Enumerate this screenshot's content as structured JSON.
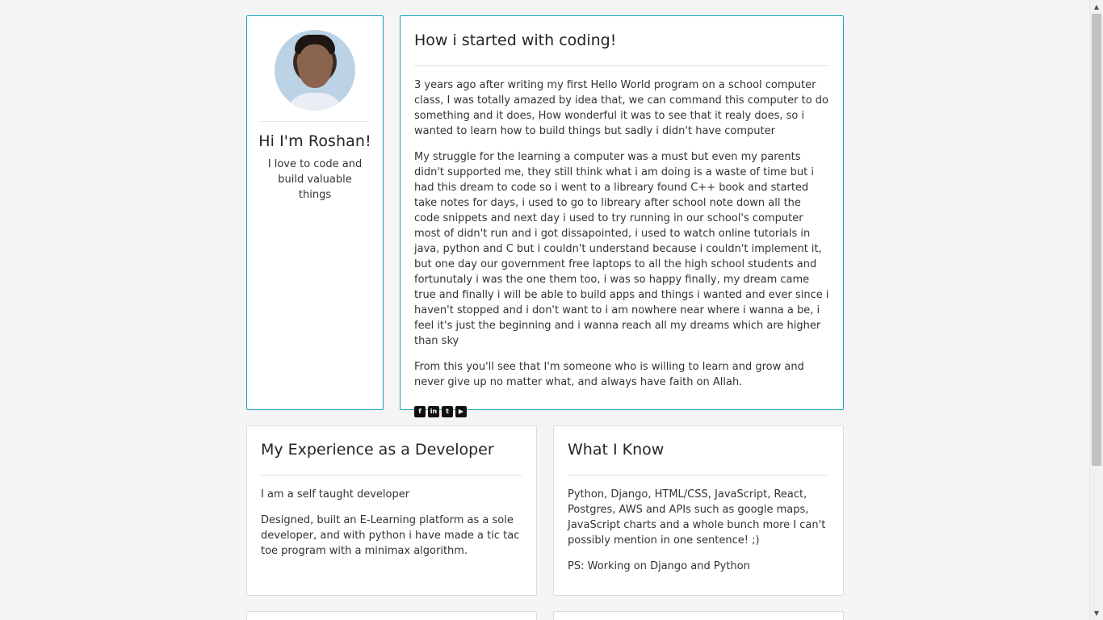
{
  "profile": {
    "greeting": "Hi I'm Roshan!",
    "tagline": "I love to code and build valuable things"
  },
  "story": {
    "title": "How i started with coding!",
    "paragraphs": [
      "3 years ago after writing my first Hello World program on a school computer class, I was totally amazed by idea that, we can command this computer to do something and it does, How wonderful it was to see that it realy does, so i wanted to learn how to build things but sadly i didn't have computer",
      "My struggle for the learning a computer was a must but even my parents didn't supported me, they still think what i am doing is a waste of time but i had this dream to code so i went to a libreary found C++ book and started take notes for days, i used to go to libreary after school note down all the code snippets and next day i used to try running in our school's computer most of didn't run and i got dissapointed, i used to watch online tutorials in java, python and C but i couldn't understand because i couldn't implement it, but one day our government free laptops to all the high school students and fortunutaly i was the one them too, i was so happy finally, my dream came true and finally i will be able to build apps and things i wanted and ever since i haven't stopped and i don't want to i am nowhere near where i wanna a be, i feel it's just the beginning and i wanna reach all my dreams which are higher than sky",
      "From this you'll see that I'm someone who is willing to learn and grow and never give up no matter what, and always have faith on Allah."
    ],
    "socials": [
      {
        "icon": "facebook-icon",
        "glyph": "f"
      },
      {
        "icon": "linkedin-icon",
        "glyph": "in"
      },
      {
        "icon": "twitter-icon",
        "glyph": "t"
      },
      {
        "icon": "youtube-icon",
        "glyph": "▶"
      }
    ]
  },
  "experience": {
    "title": "My Experience as a Developer",
    "paragraphs": [
      "I am a self taught developer",
      "Designed, built an E-Learning platform as a sole developer, and with python i have made a tic tac toe program with a minimax algorithm."
    ]
  },
  "skills": {
    "title": "What I Know",
    "paragraphs": [
      "Python, Django, HTML/CSS, JavaScript, React, Postgres, AWS and APIs such as google maps, JavaScript charts and a whole bunch more I can't possibly mention in one sentence! ;)",
      "PS: Working on Django and Python"
    ]
  },
  "colors": {
    "accent_border": "#17a2b8",
    "page_background": "#f5f5f5"
  }
}
